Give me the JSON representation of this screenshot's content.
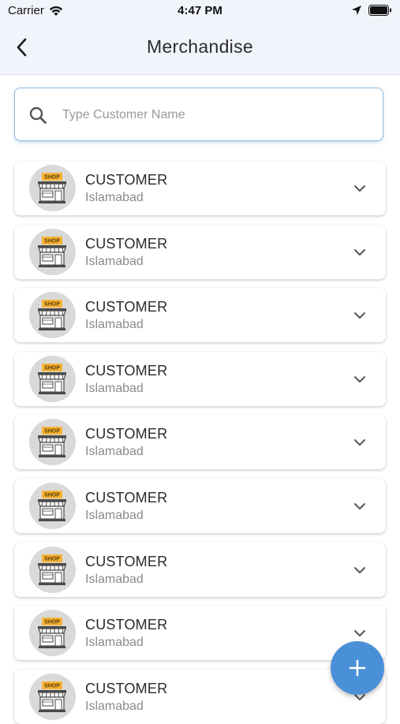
{
  "status_bar": {
    "carrier": "Carrier",
    "time": "4:47 PM",
    "icons": [
      "wifi-icon",
      "location-arrow-icon",
      "battery-icon"
    ]
  },
  "header": {
    "title": "Merchandise",
    "back_icon": "chevron-left-icon"
  },
  "search": {
    "placeholder": "Type Customer Name",
    "value": "",
    "icon": "search-icon"
  },
  "customers": [
    {
      "name": "CUSTOMER",
      "city": "Islamabad",
      "badge": "SHOP"
    },
    {
      "name": "CUSTOMER",
      "city": "Islamabad",
      "badge": "SHOP"
    },
    {
      "name": "CUSTOMER",
      "city": "Islamabad",
      "badge": "SHOP"
    },
    {
      "name": "CUSTOMER",
      "city": "Islamabad",
      "badge": "SHOP"
    },
    {
      "name": "CUSTOMER",
      "city": "Islamabad",
      "badge": "SHOP"
    },
    {
      "name": "CUSTOMER",
      "city": "Islamabad",
      "badge": "SHOP"
    },
    {
      "name": "CUSTOMER",
      "city": "Islamabad",
      "badge": "SHOP"
    },
    {
      "name": "CUSTOMER",
      "city": "Islamabad",
      "badge": "SHOP"
    },
    {
      "name": "CUSTOMER",
      "city": "Islamabad",
      "badge": "SHOP"
    }
  ],
  "fab": {
    "icon": "plus-icon"
  },
  "colors": {
    "header_bg": "#f1f4fa",
    "accent": "#4a90d9",
    "search_border": "#8fb8de",
    "shop_badge": "#f5b335",
    "avatar_bg": "#d9d9d9"
  }
}
